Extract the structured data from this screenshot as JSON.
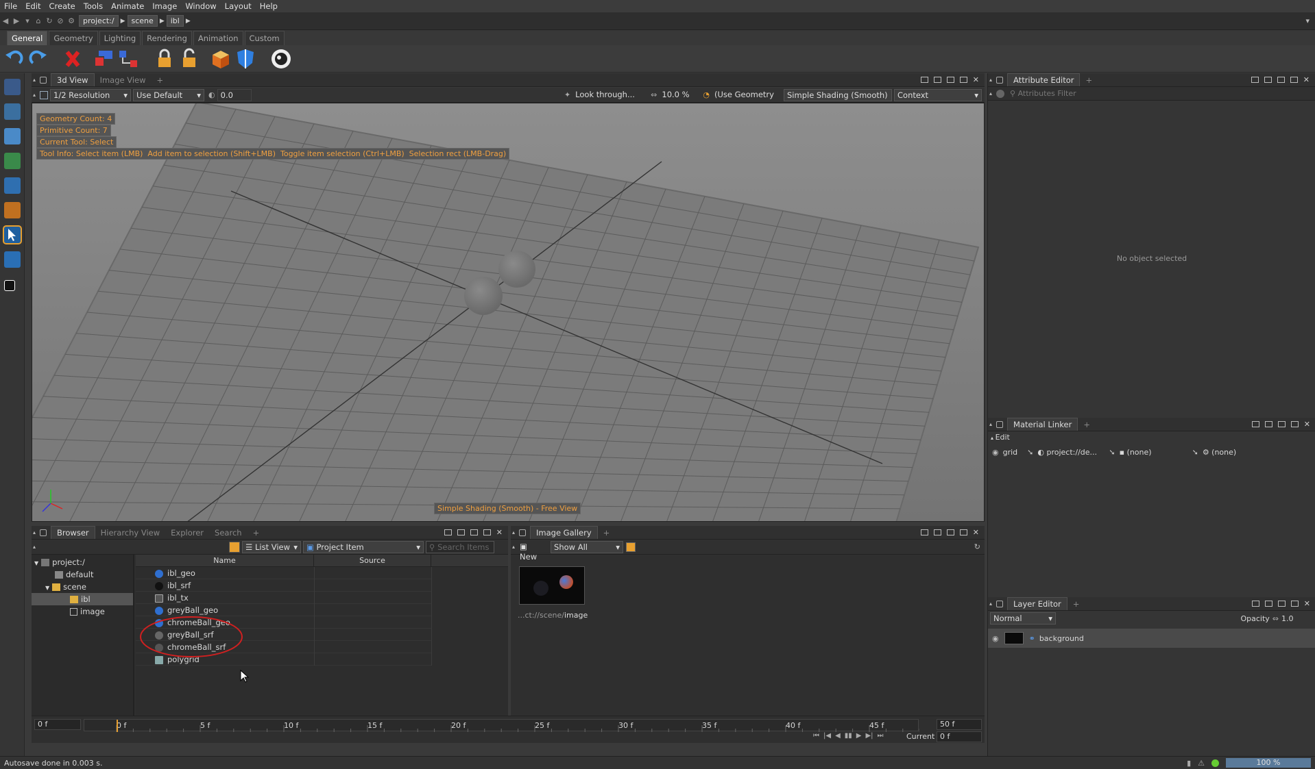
{
  "menu": [
    "File",
    "Edit",
    "Create",
    "Tools",
    "Animate",
    "Image",
    "Window",
    "Layout",
    "Help"
  ],
  "breadcrumb": [
    "project:/",
    "scene",
    "ibl"
  ],
  "shelf_tabs": [
    {
      "label": "General",
      "active": true
    },
    {
      "label": "Geometry",
      "active": false
    },
    {
      "label": "Lighting",
      "active": false
    },
    {
      "label": "Rendering",
      "active": false
    },
    {
      "label": "Animation",
      "active": false
    },
    {
      "label": "Custom",
      "active": false
    }
  ],
  "viewport": {
    "tabs": [
      "3d View",
      "Image View"
    ],
    "resolution": "1/2 Resolution",
    "use_default": "Use Default",
    "value": "0.0",
    "look_through": "Look through...",
    "percent": "10.0 %",
    "use_geometry": "(Use Geometry",
    "shading": "Simple Shading (Smooth)",
    "context": "Context",
    "overlay_lines": [
      "Geometry Count: 4",
      "Primitive Count: 7",
      "Current Tool: Select"
    ],
    "tool_info": "Tool Info: Select item (LMB)  Add item to selection (Shift+LMB)  Toggle item selection (Ctrl+LMB)  Selection rect (LMB-Drag)",
    "mode_label": "Simple Shading (Smooth) - Free View"
  },
  "browser": {
    "tabs": [
      "Browser",
      "Hierarchy View",
      "Explorer",
      "Search"
    ],
    "view_mode": "List View",
    "item_type": "Project Item",
    "search_placeholder": "Search Items",
    "tree": [
      {
        "label": "project:/",
        "indent": 0
      },
      {
        "label": "default",
        "indent": 1
      },
      {
        "label": "scene",
        "indent": 1
      },
      {
        "label": "ibl",
        "indent": 2,
        "selected": true
      },
      {
        "label": "image",
        "indent": 2
      }
    ],
    "columns": [
      "Name",
      "Source"
    ],
    "items": [
      "ibl_geo",
      "ibl_srf",
      "ibl_tx",
      "greyBall_geo",
      "chromeBall_geo",
      "greyBall_srf",
      "chromeBall_srf",
      "polygrid"
    ]
  },
  "gallery": {
    "tab": "Image Gallery",
    "new_label": "New",
    "filter": "Show All",
    "caption_prefix": "...ct://scene/",
    "caption_name": "image"
  },
  "attribute_editor": {
    "tab": "Attribute Editor",
    "filter_placeholder": "Attributes Filter",
    "empty_text": "No object selected"
  },
  "material_linker": {
    "tab": "Material Linker",
    "edit_label": "Edit",
    "row": {
      "name": "grid",
      "material": "project://de...",
      "mid": "(none)",
      "right": "(none)"
    }
  },
  "layer_editor": {
    "tab": "Layer Editor",
    "blend": "Normal",
    "opacity_label": "Opacity",
    "opacity_value": "1.0",
    "layer": "background"
  },
  "timeline": {
    "start": "0 f",
    "end": "50 f",
    "ticks": [
      "0 f",
      "5 f",
      "10 f",
      "15 f",
      "20 f",
      "25 f",
      "30 f",
      "35 f",
      "40 f",
      "45 f",
      "50 f"
    ],
    "current_label": "Current",
    "current_value": "0 f"
  },
  "status": {
    "message": "Autosave done in 0.003 s.",
    "zoom": "100 %"
  }
}
